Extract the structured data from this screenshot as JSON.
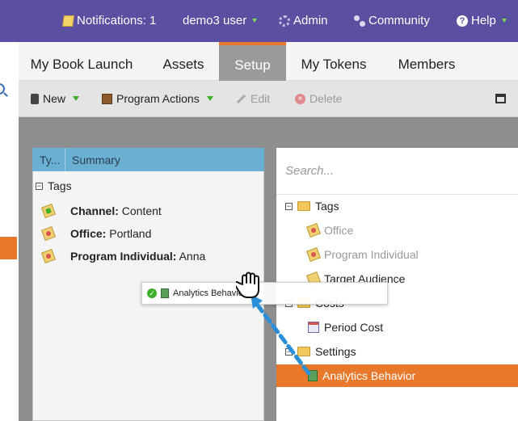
{
  "topbar": {
    "notifications": "Notifications: 1",
    "user": "demo3 user",
    "admin": "Admin",
    "community": "Community",
    "help": "Help"
  },
  "tabs": [
    "My Book Launch",
    "Assets",
    "Setup",
    "My Tokens",
    "Members"
  ],
  "toolbar": {
    "new": "New",
    "program_actions": "Program Actions",
    "edit": "Edit",
    "delete": "Delete"
  },
  "left_panel": {
    "col_type": "Ty...",
    "col_summary": "Summary",
    "group": "Tags",
    "rows": [
      {
        "label": "Channel:",
        "value": "Content"
      },
      {
        "label": "Office:",
        "value": "Portland"
      },
      {
        "label": "Program Individual:",
        "value": "Anna"
      }
    ]
  },
  "right_panel": {
    "search_placeholder": "Search...",
    "tags_group": "Tags",
    "tags": [
      "Office",
      "Program Individual",
      "Target Audience"
    ],
    "costs_group": "Costs",
    "costs": [
      "Period Cost"
    ],
    "settings_group": "Settings",
    "settings": [
      "Analytics Behavior"
    ]
  },
  "drag_ghost": {
    "label": "Analytics Behavior"
  },
  "colors": {
    "topbar": "#5a4fa0",
    "accent": "#e8782b",
    "header_blue": "#6ab0d2",
    "drag_arrow": "#2a8fd6"
  }
}
